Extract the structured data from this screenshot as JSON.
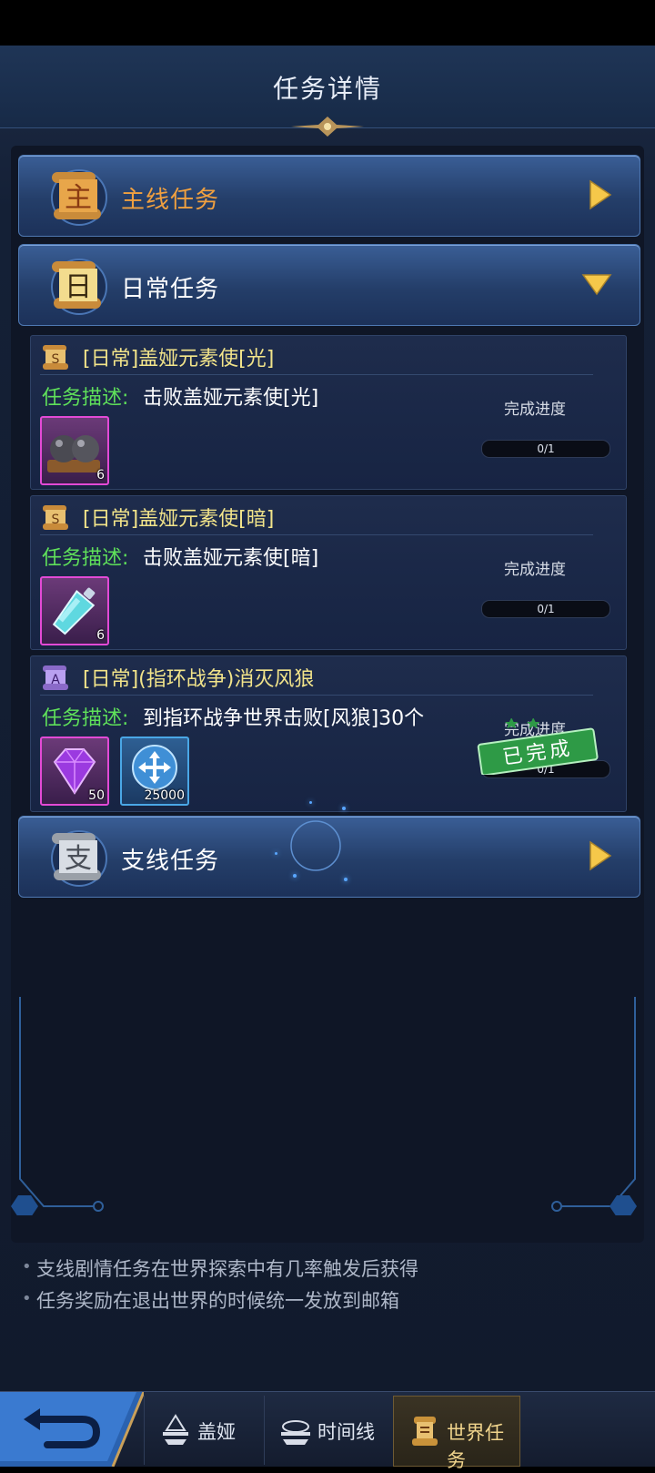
{
  "header": {
    "title": "任务详情"
  },
  "categories": {
    "main": {
      "label": "主线任务",
      "emblem_char": "主",
      "state": "collapsed"
    },
    "daily": {
      "label": "日常任务",
      "emblem_char": "日",
      "state": "expanded"
    },
    "side": {
      "label": "支线任务",
      "emblem_char": "支",
      "state": "collapsed"
    }
  },
  "common": {
    "desc_label": "任务描述:",
    "progress_label": "完成进度"
  },
  "tasks": [
    {
      "title": "[日常]盖娅元素使[光]",
      "desc": "击败盖娅元素使[光]",
      "progress": "0/1",
      "progress_fraction": 0,
      "rewards": [
        {
          "icon": "cannonball-icon",
          "count": "6"
        }
      ]
    },
    {
      "title": "[日常]盖娅元素使[暗]",
      "desc": "击败盖娅元素使[暗]",
      "progress": "0/1",
      "progress_fraction": 0,
      "rewards": [
        {
          "icon": "potion-icon",
          "count": "6"
        }
      ]
    },
    {
      "title": "[日常](指环战争)消灭风狼",
      "desc": "到指环战争世界击败[风狼]30个",
      "progress": "0/1",
      "progress_fraction": 0,
      "stamp": "已完成",
      "rewards": [
        {
          "icon": "purple-gem-icon",
          "count": "50"
        },
        {
          "icon": "experience-icon",
          "count": "25000"
        }
      ]
    }
  ],
  "notes": [
    "支线剧情任务在世界探索中有几率触发后获得",
    "任务奖励在退出世界的时候统一发放到邮箱"
  ],
  "tabbar": {
    "tabs": [
      {
        "label": "盖娅",
        "icon": "gaia-icon"
      },
      {
        "label": "时间线",
        "icon": "timeline-icon"
      },
      {
        "label": "世界任务",
        "icon": "world-task-icon",
        "active": true
      }
    ]
  },
  "colors": {
    "title_yellow": "#f2e48a",
    "desc_green": "#5fe05a",
    "main_label_orange": "#f0a040",
    "stamp_green": "#2e9a46"
  }
}
